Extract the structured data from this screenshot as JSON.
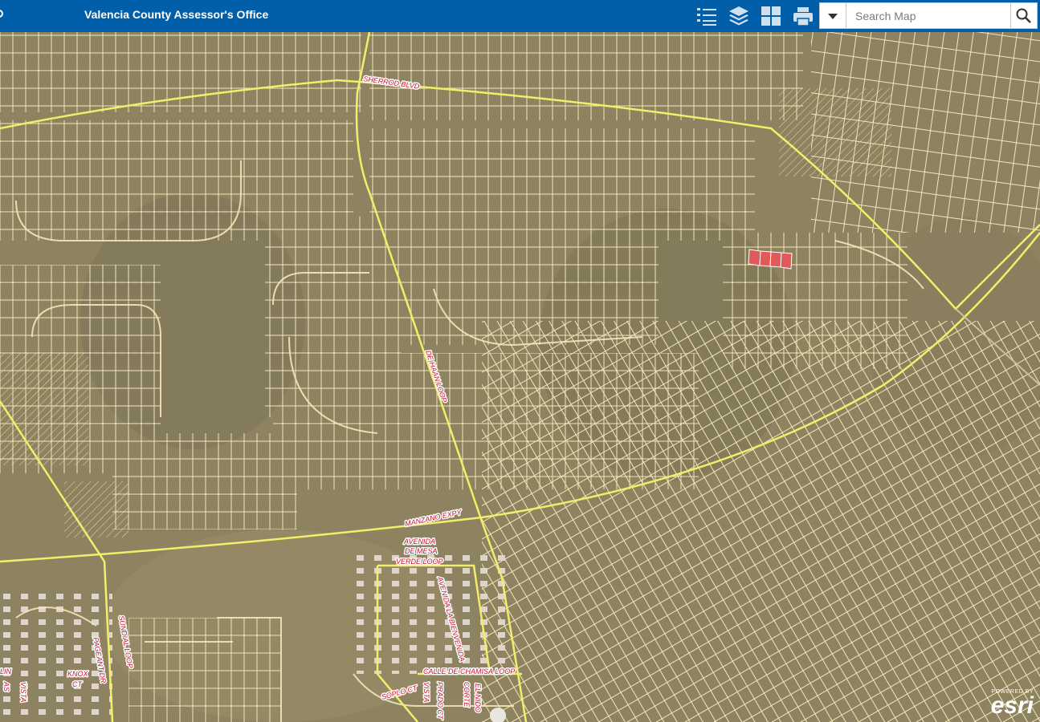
{
  "header": {
    "title": "Valencia County Assessor's Office",
    "toolbar_icons": [
      "legend-list-icon",
      "layers-icon",
      "basemap-gallery-icon",
      "print-icon"
    ],
    "search": {
      "placeholder": "Search Map",
      "value": ""
    }
  },
  "map": {
    "road_labels": {
      "sherrod": "SHERROD BLVD",
      "dehaan": "DE HAAN LOOP",
      "manzano": "MANZANO EXPY",
      "avenida_mesa_1": "AVENIDA",
      "avenida_mesa_2": "DE MESA",
      "avenida_mesa_3": "VERDE LOOP",
      "bienvenida": "AVENIDA LA BIENVENIDA",
      "chamisa": "CALLE DE CHAMISA LOOP",
      "soplo": "SOPLO CT",
      "vista": "VISTA",
      "prado": "PRADO CT",
      "corte": "CORTE",
      "elnido": "EL NIDO",
      "knox1": "KNOX",
      "knox2": "CT",
      "pageant": "PAGEANT DR",
      "sundial": "SUNDIAL LOOP",
      "lin": "LIN",
      "as": "AS",
      "vista2": "VISTA"
    },
    "highlight_color": "#e05a5a",
    "road_color": "#f2ee6a",
    "parcel_line_color": "#f3e6b8"
  },
  "attribution": {
    "powered": "POWERED BY",
    "logo": "esri"
  }
}
